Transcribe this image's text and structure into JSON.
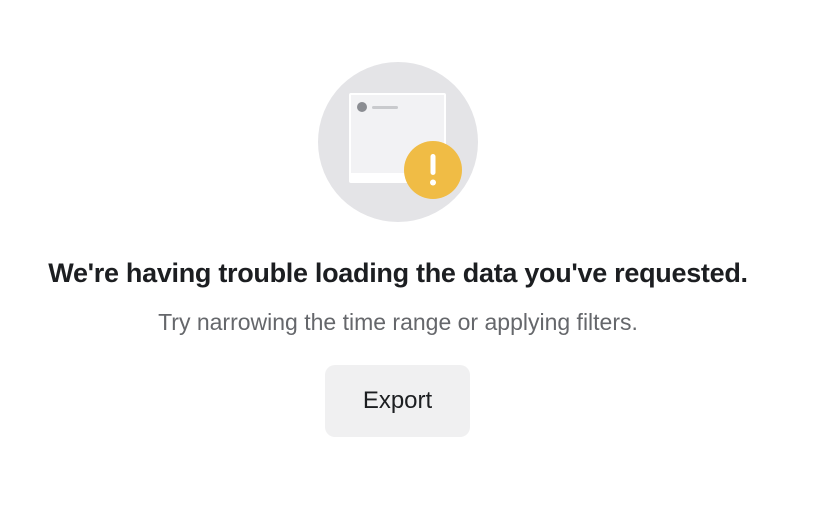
{
  "empty_state": {
    "illustration_icon": "warning-data-card-illustration",
    "warning_icon": "exclamation-icon",
    "title": "We're having trouble loading the data you've requested.",
    "message": "Try narrowing the time range or applying filters.",
    "export_button_label": "Export"
  },
  "colors": {
    "illustration_background": "#e4e4e7",
    "warning_badge": "#f0bc45",
    "title_text": "#1c1e21",
    "message_text": "#65676b",
    "button_background": "#f0f0f1"
  }
}
